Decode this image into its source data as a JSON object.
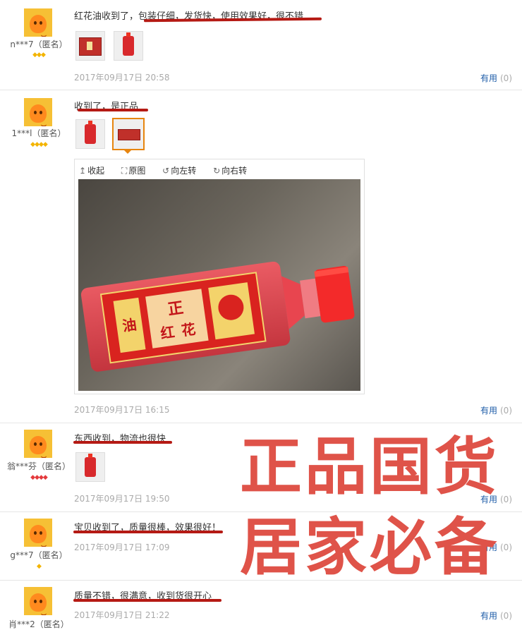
{
  "reviews": [
    {
      "user": "n***7（匿名）",
      "rank_icons": "◆◆◆",
      "text": "红花油收到了，包装仔细，发货快，使用效果好，很不错",
      "date": "2017年09月17日 20:58",
      "useful_label": "有用",
      "useful_count": "(0)"
    },
    {
      "user": "1***l（匿名）",
      "rank_icons": "◆◆◆◆",
      "text": "收到了，是正品",
      "date": "2017年09月17日 16:15",
      "useful_label": "有用",
      "useful_count": "(0)",
      "viewer": {
        "collapse": "收起",
        "original": "原图",
        "rotate_left": "向左转",
        "rotate_right": "向右转"
      },
      "photo": {
        "label_top": "正",
        "label_mid": "红",
        "label_bottom": "花",
        "label_last": "油"
      }
    },
    {
      "user": "翁***芬（匿名）",
      "rank_icons": "◆◆◆◆",
      "text": "东西收到，物流也很快",
      "date": "2017年09月17日 19:50",
      "useful_label": "有用",
      "useful_count": "(0)"
    },
    {
      "user": "g***7（匿名）",
      "rank_icons": "◆",
      "text": "宝贝收到了，质量很棒，效果很好！",
      "date": "2017年09月17日 17:09",
      "useful_label": "有用",
      "useful_count": "(0)"
    },
    {
      "user": "肖***2（匿名）",
      "text": "质量不错，很满意，收到货很开心",
      "date": "2017年09月17日 21:22",
      "useful_label": "有用",
      "useful_count": "(0)"
    }
  ],
  "overlay": {
    "line1": "正品国货",
    "line2": "居家必备"
  },
  "colors": {
    "link": "#1e5ca8",
    "underline": "#b51a14",
    "overlay": "#df5349",
    "selected_border": "#e7850f"
  }
}
